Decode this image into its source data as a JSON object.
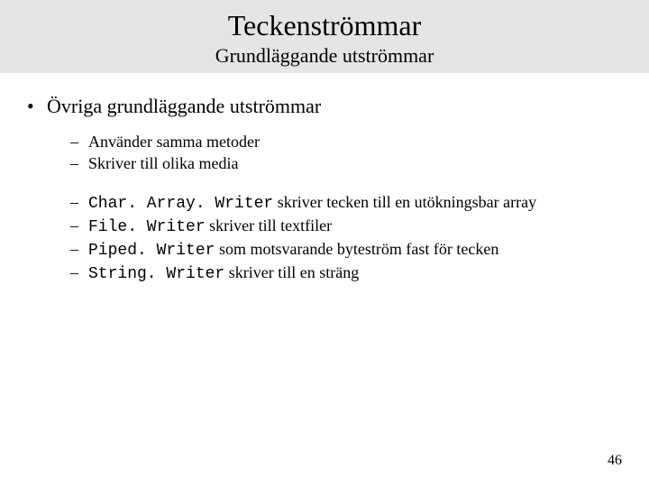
{
  "header": {
    "title": "Teckenströmmar",
    "subtitle": "Grundläggande utströmmar"
  },
  "bullet_main": "Övriga grundläggande utströmmar",
  "sub_group_a": [
    "Använder samma metoder",
    "Skriver till olika media"
  ],
  "sub_group_b": [
    {
      "code": "Char. Array. Writer",
      "rest": " skriver tecken till en utökningsbar array"
    },
    {
      "code": "File. Writer",
      "rest": " skriver till textfiler"
    },
    {
      "code": "Piped. Writer",
      "rest": " som motsvarande byteström fast för tecken"
    },
    {
      "code": "String. Writer",
      "rest": " skriver till en sträng"
    }
  ],
  "page_number": "46"
}
